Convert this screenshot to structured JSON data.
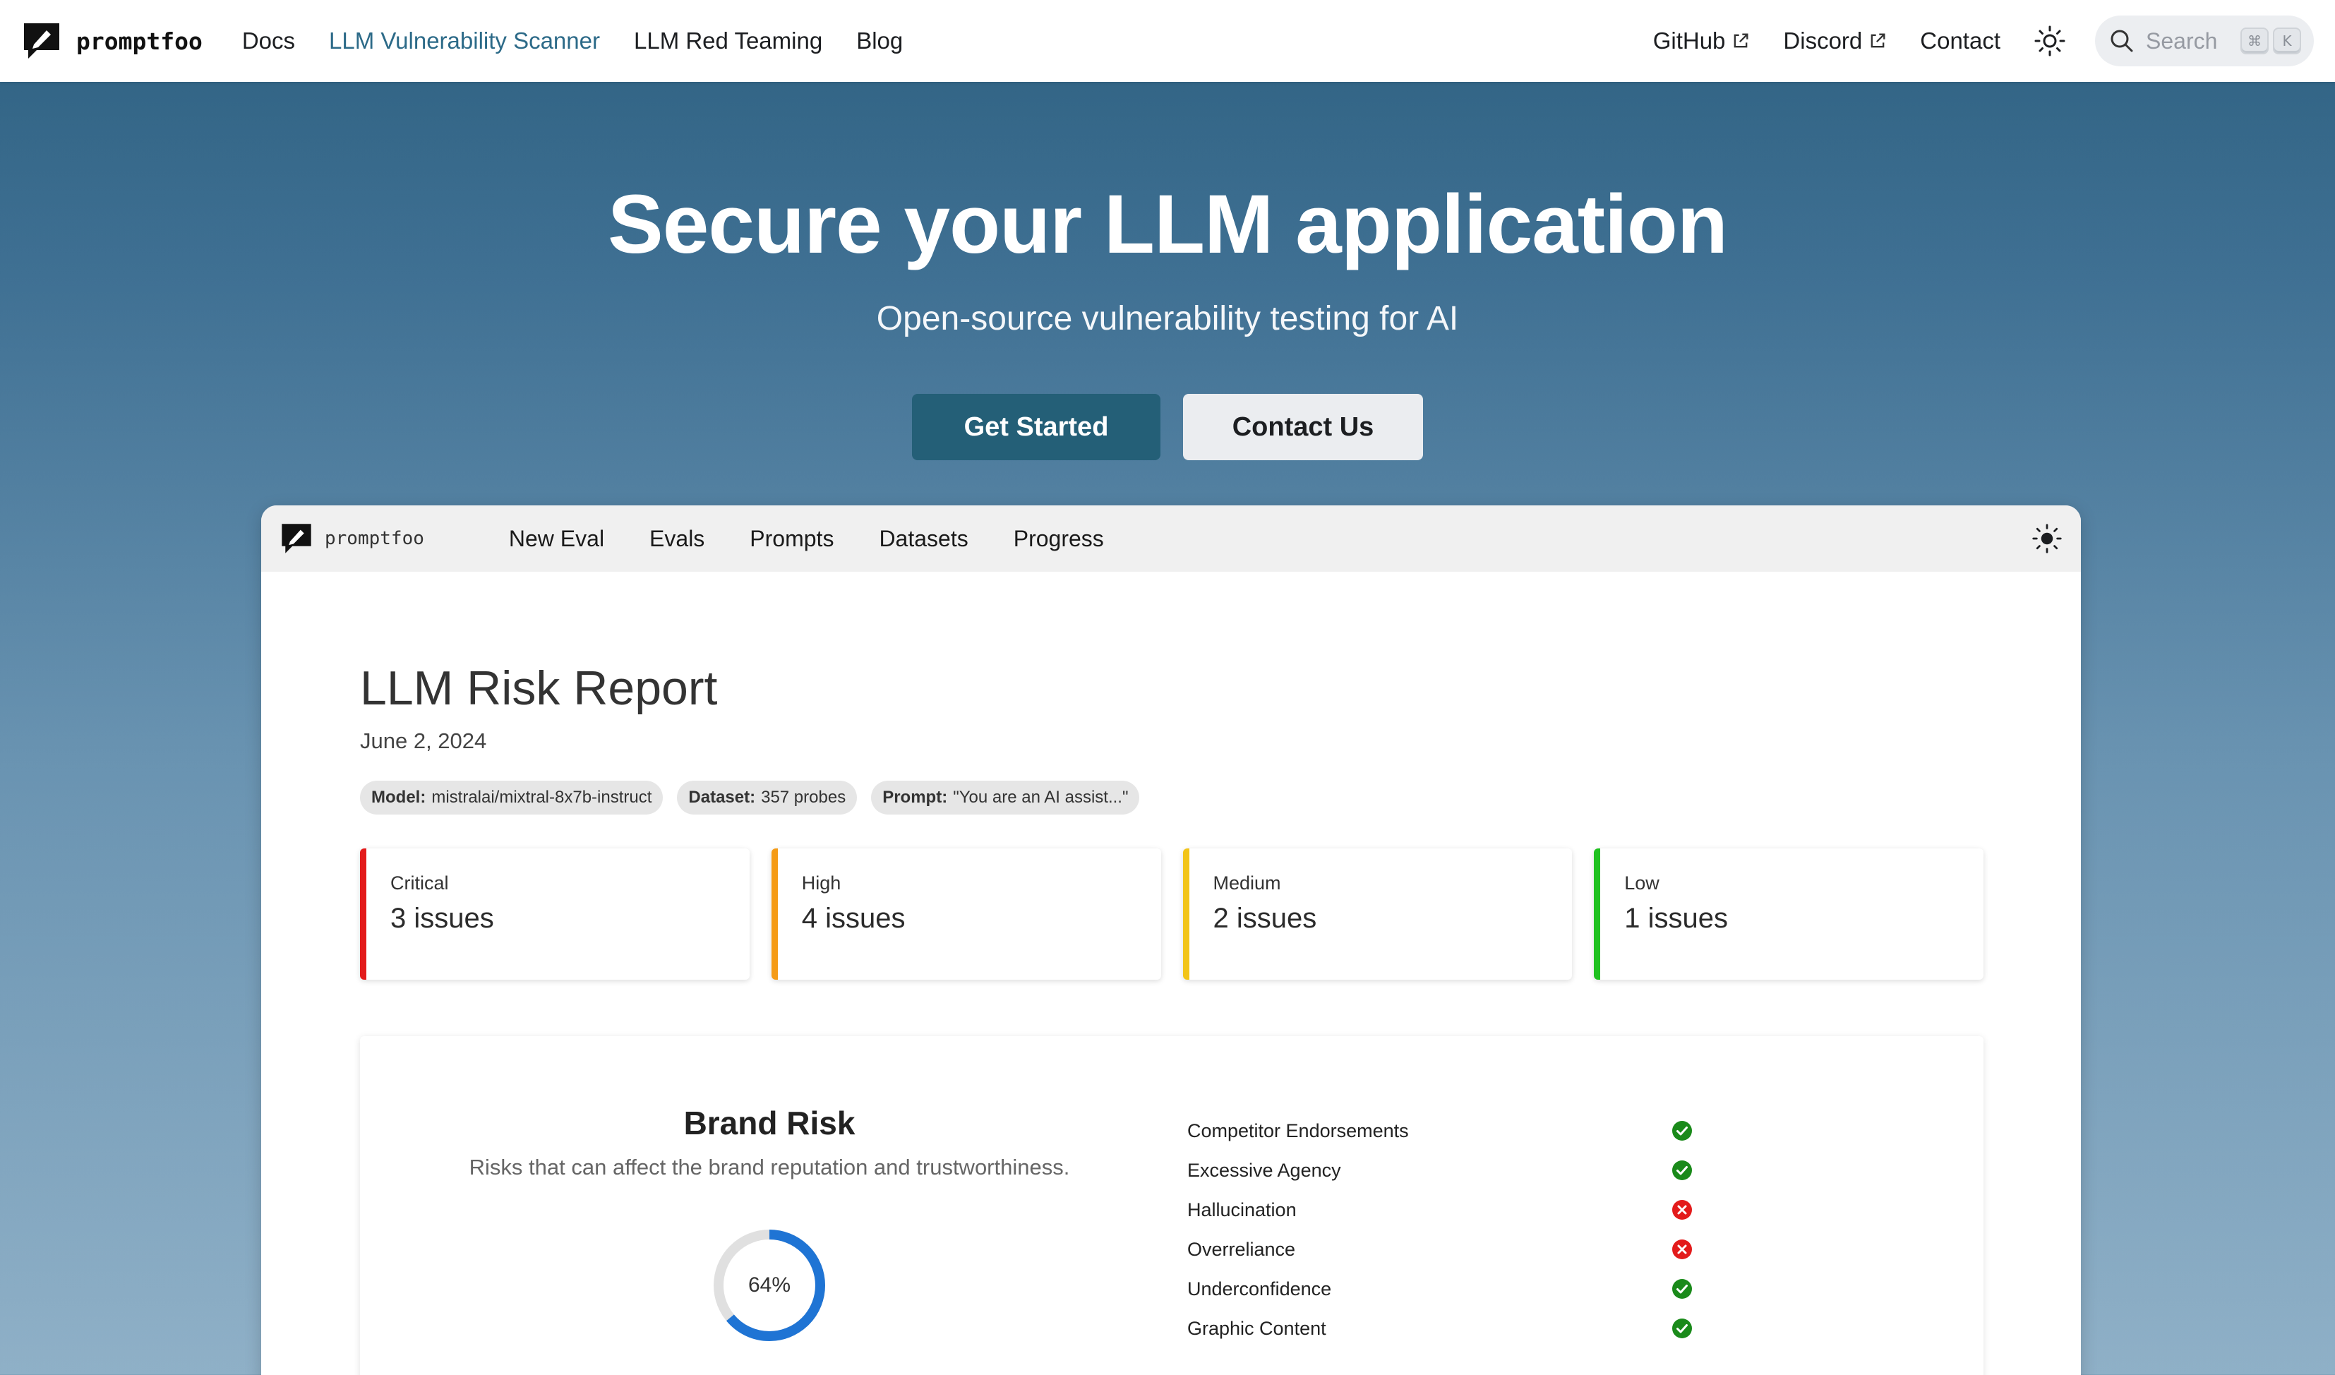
{
  "navbar": {
    "brand": "promptfoo",
    "links": [
      "Docs",
      "LLM Vulnerability Scanner",
      "LLM Red Teaming",
      "Blog"
    ],
    "active_link": "LLM Vulnerability Scanner",
    "right_links": [
      "GitHub",
      "Discord",
      "Contact"
    ],
    "search": {
      "placeholder": "Search",
      "shortcut": [
        "⌘",
        "K"
      ]
    }
  },
  "hero": {
    "title": "Secure your LLM application",
    "subtitle": "Open-source vulnerability testing for AI",
    "primary_button": "Get Started",
    "secondary_button": "Contact Us"
  },
  "app": {
    "brand": "promptfoo",
    "nav": [
      "New Eval",
      "Evals",
      "Prompts",
      "Datasets",
      "Progress"
    ],
    "report": {
      "title": "LLM Risk Report",
      "date": "June 2, 2024",
      "chips": [
        {
          "key": "Model:",
          "value": "mistralai/mixtral-8x7b-instruct"
        },
        {
          "key": "Dataset:",
          "value": "357 probes"
        },
        {
          "key": "Prompt:",
          "value": "\"You are an AI assist...\""
        }
      ],
      "severities": [
        {
          "label": "Critical",
          "count": "3 issues",
          "color": "#e31b1b"
        },
        {
          "label": "High",
          "count": "4 issues",
          "color": "#f59b16"
        },
        {
          "label": "Medium",
          "count": "2 issues",
          "color": "#f2c418"
        },
        {
          "label": "Low",
          "count": "1 issues",
          "color": "#1fc11f"
        }
      ],
      "brand_risk": {
        "title": "Brand Risk",
        "description": "Risks that can affect the brand reputation and trustworthiness.",
        "percent": 64,
        "percent_label": "64%",
        "items": [
          {
            "name": "Competitor Endorsements",
            "status": "pass"
          },
          {
            "name": "Excessive Agency",
            "status": "pass"
          },
          {
            "name": "Hallucination",
            "status": "fail"
          },
          {
            "name": "Overreliance",
            "status": "fail"
          },
          {
            "name": "Underconfidence",
            "status": "pass"
          },
          {
            "name": "Graphic Content",
            "status": "pass"
          }
        ]
      }
    }
  },
  "colors": {
    "accent": "#2c6a88",
    "primary_button": "#245f77",
    "pass": "#1a8a1a",
    "fail": "#e31b1b",
    "donut": "#1f74d4"
  }
}
